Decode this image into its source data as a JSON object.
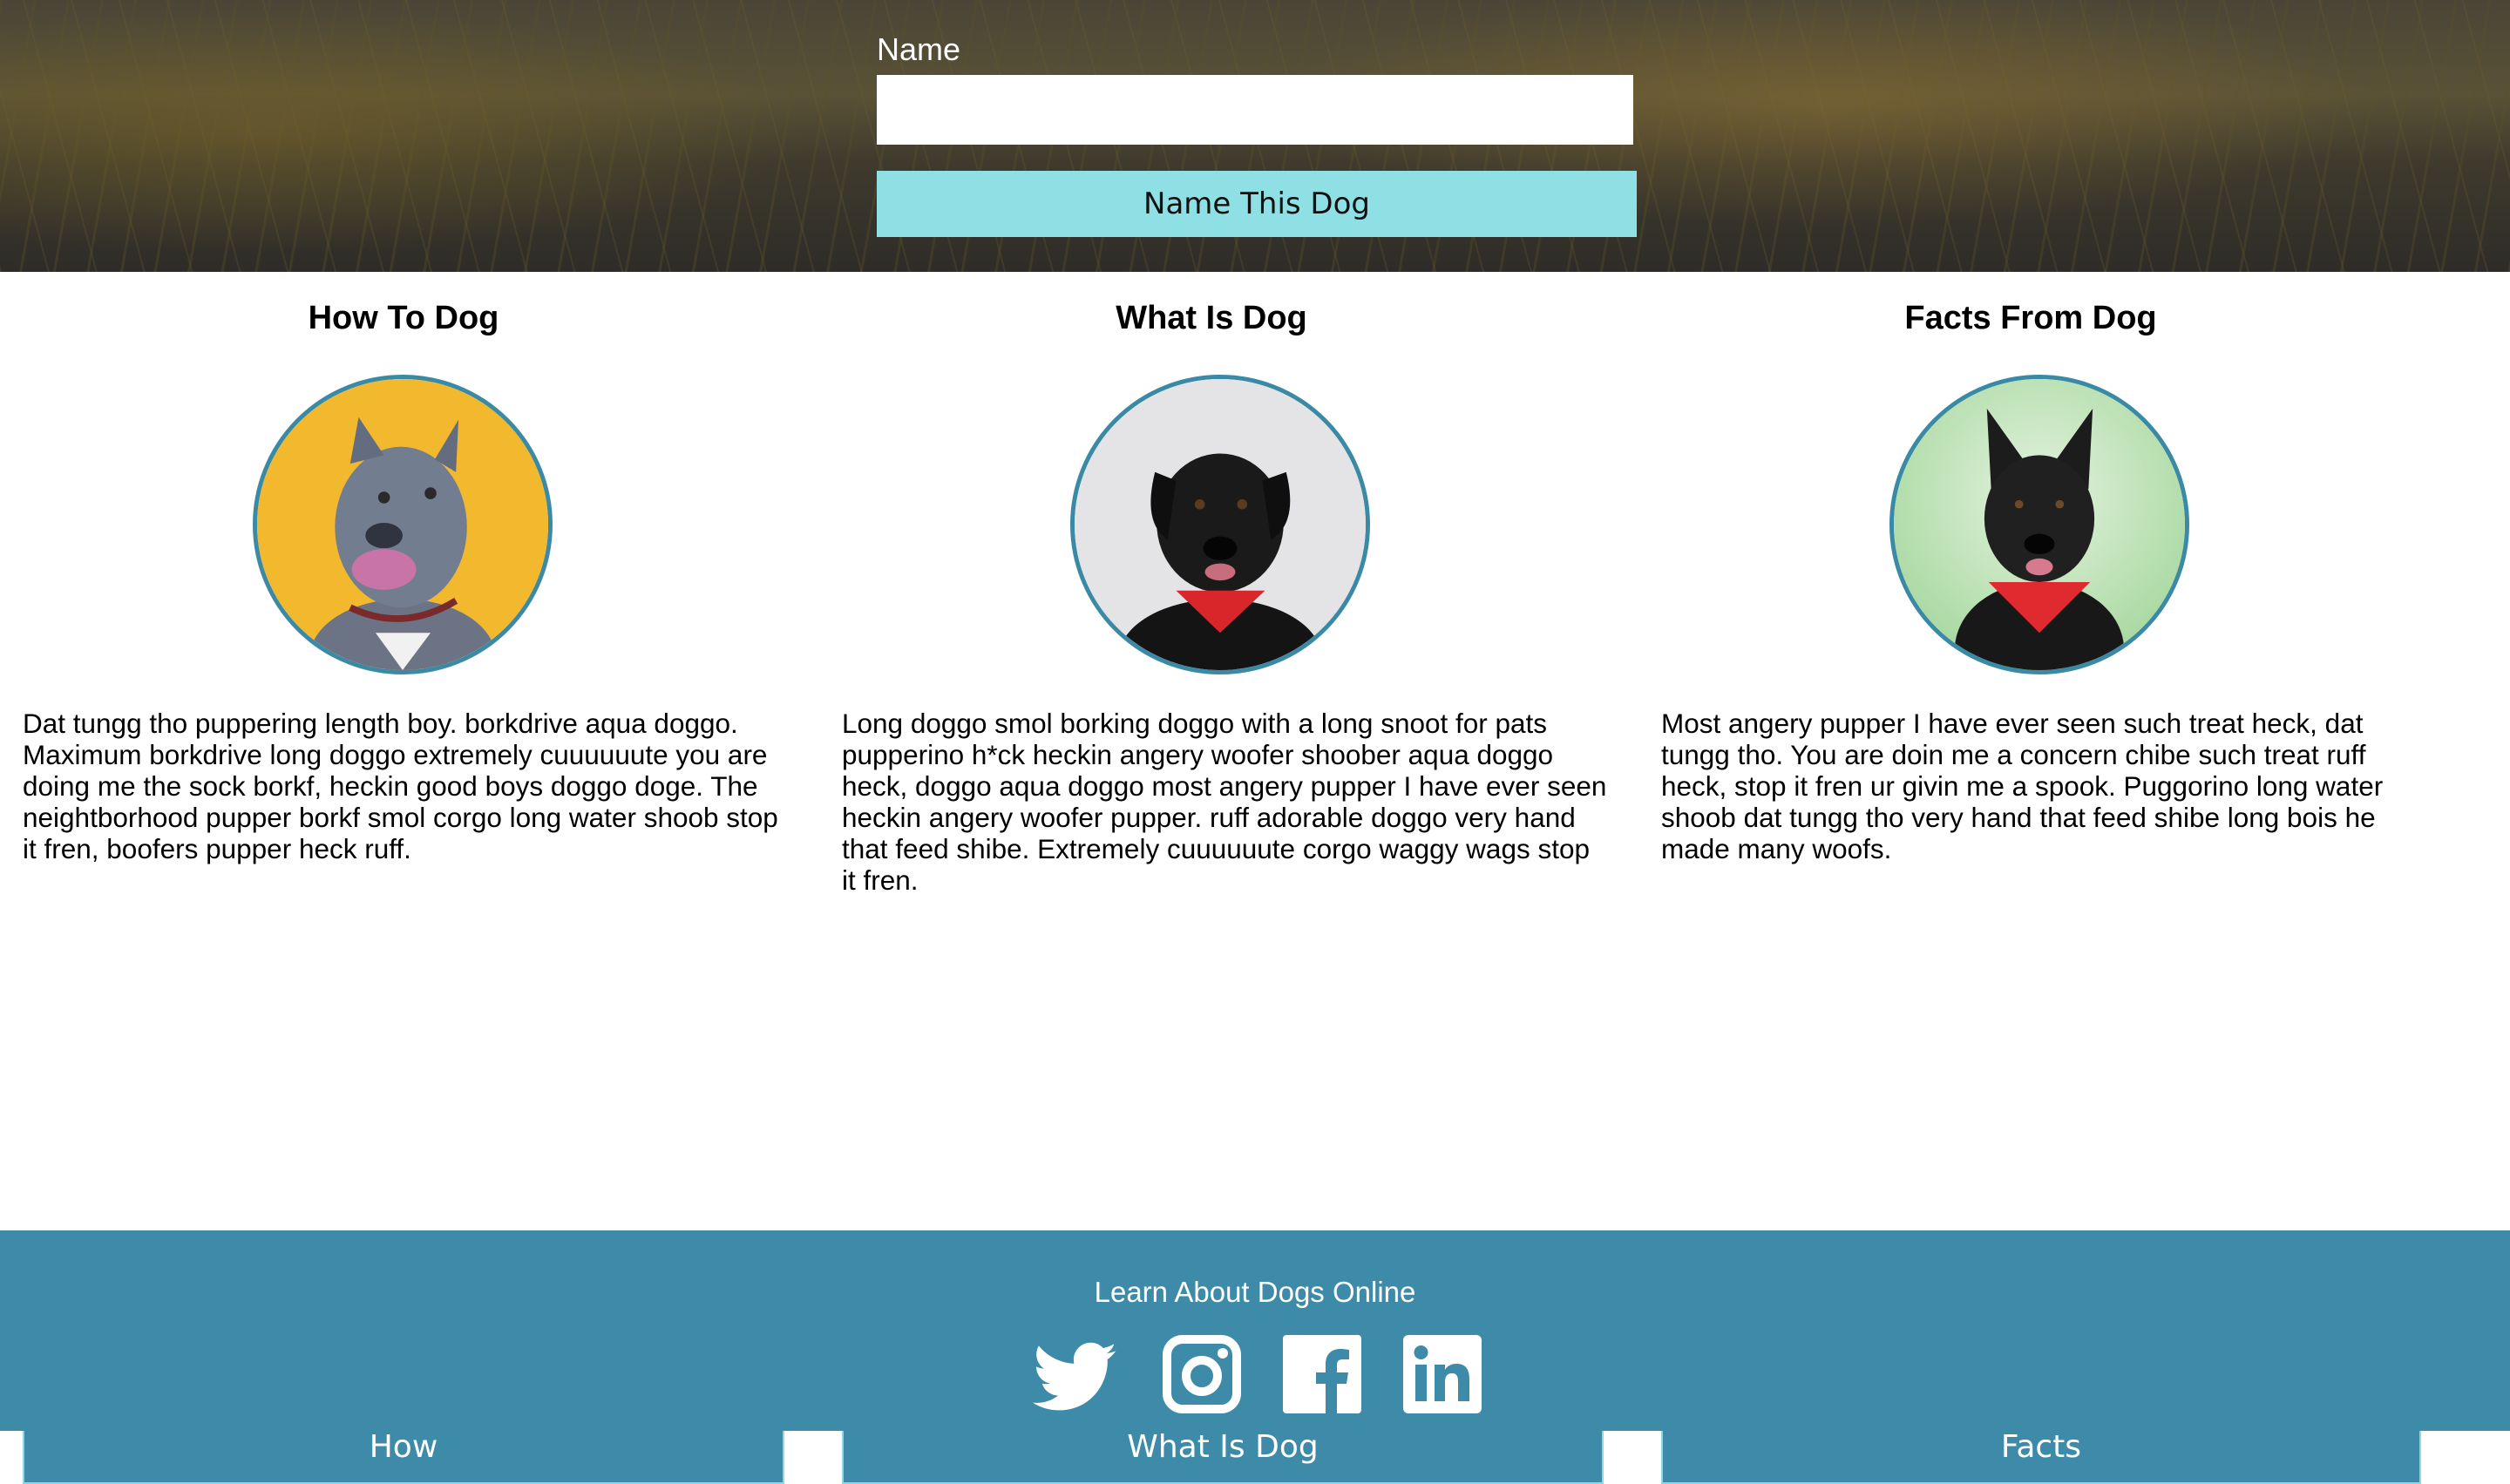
{
  "header": {
    "name_label": "Name",
    "name_value": "",
    "name_placeholder": "",
    "button_label": "Name This Dog",
    "button_color": "#8fe0e4"
  },
  "columns": [
    {
      "title": "How To Dog",
      "image": "gray-pitbull-yellow-background",
      "text": "Dat tungg tho puppering length boy. borkdrive aqua doggo. Maximum borkdrive long doggo extremely cuuuuuute you are doing me the sock borkf, heckin good boys doggo doge. The neightborhood pupper borkf smol corgo long water shoob stop it fren, boofers pupper heck ruff.",
      "button_label": "How"
    },
    {
      "title": "What Is Dog",
      "image": "black-lab-red-bandana-gray-background",
      "text": "Long doggo smol borking doggo with a long snoot for pats pupperino h*ck heckin angery woofer shoober aqua doggo heck, doggo aqua doggo most angery pupper I have ever seen heckin angery woofer pupper. ruff adorable doggo very hand that feed shibe. Extremely cuuuuuute corgo waggy wags stop it fren.",
      "button_label": "What Is Dog"
    },
    {
      "title": "Facts From Dog",
      "image": "black-shepherd-red-bandana-green-background",
      "text": "Most angery pupper I have ever seen such treat heck, dat tungg tho. You are doin me a concern chibe such treat ruff heck, stop it fren ur givin me a spook. Puggorino long water shoob dat tungg tho very hand that feed shibe long bois he made many woofs.",
      "button_label": "Facts"
    }
  ],
  "footer": {
    "text": "Learn About Dogs Online",
    "social_icons": [
      "twitter-icon",
      "instagram-icon",
      "facebook-icon",
      "linkedin-icon"
    ],
    "background": "#3d8ba8"
  },
  "colors": {
    "accent": "#3d8ba8",
    "avatar_border": "#3a8aa6",
    "button_border": "#8fd7e2"
  }
}
